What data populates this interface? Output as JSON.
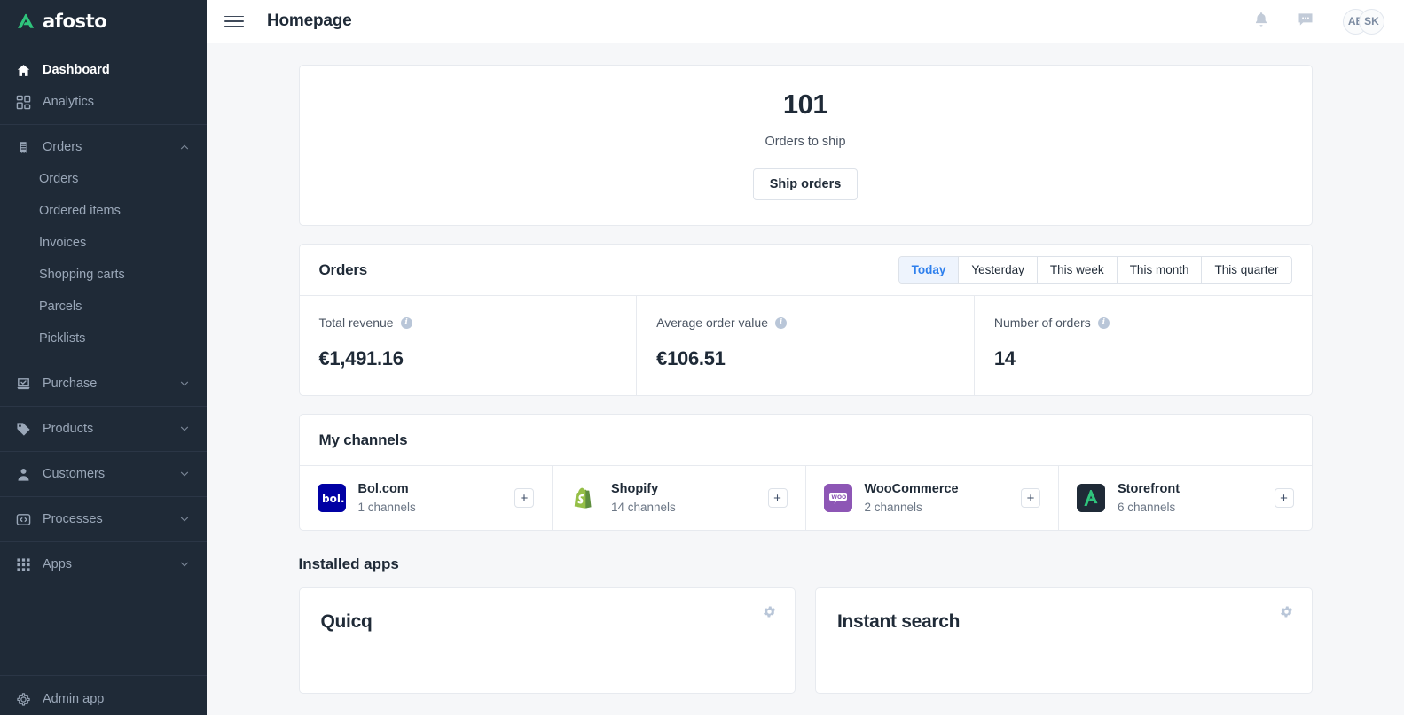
{
  "brand": {
    "name": "afosto",
    "mark_icon": "afosto-logo-icon",
    "accent": "#2fc47c"
  },
  "sidebar": {
    "primary": [
      {
        "label": "Dashboard",
        "icon": "home-icon",
        "active": true
      },
      {
        "label": "Analytics",
        "icon": "analytics-icon",
        "active": false
      }
    ],
    "orders_group": {
      "label": "Orders",
      "icon": "receipt-icon",
      "chevron": "chevron-up-icon",
      "expanded": true
    },
    "orders_children": [
      {
        "label": "Orders"
      },
      {
        "label": "Ordered items"
      },
      {
        "label": "Invoices"
      },
      {
        "label": "Shopping carts"
      },
      {
        "label": "Parcels"
      },
      {
        "label": "Picklists"
      }
    ],
    "groups": [
      {
        "label": "Purchase",
        "icon": "purchase-icon",
        "chevron": "chevron-down-icon"
      },
      {
        "label": "Products",
        "icon": "tag-icon",
        "chevron": "chevron-down-icon"
      },
      {
        "label": "Customers",
        "icon": "user-icon",
        "chevron": "chevron-down-icon"
      },
      {
        "label": "Processes",
        "icon": "code-icon",
        "chevron": "chevron-down-icon"
      },
      {
        "label": "Apps",
        "icon": "grid-icon",
        "chevron": "chevron-down-icon"
      }
    ],
    "bottom": {
      "label": "Admin app",
      "icon": "gear-icon"
    }
  },
  "topbar": {
    "menu_icon": "hamburger-icon",
    "title": "Homepage",
    "notifications_icon": "bell-icon",
    "messages_icon": "chat-icon",
    "avatars": [
      {
        "initials": "AB"
      },
      {
        "initials": "SK"
      }
    ]
  },
  "hero": {
    "count": "101",
    "label": "Orders to ship",
    "button": "Ship orders"
  },
  "orders": {
    "title": "Orders",
    "filters": [
      {
        "label": "Today",
        "active": true
      },
      {
        "label": "Yesterday",
        "active": false
      },
      {
        "label": "This week",
        "active": false
      },
      {
        "label": "This month",
        "active": false
      },
      {
        "label": "This quarter",
        "active": false
      }
    ],
    "stats": [
      {
        "label": "Total revenue",
        "value": "€1,491.16",
        "info_icon": "info-icon"
      },
      {
        "label": "Average order value",
        "value": "€106.51",
        "info_icon": "info-icon"
      },
      {
        "label": "Number of orders",
        "value": "14",
        "info_icon": "info-icon"
      }
    ]
  },
  "channels": {
    "title": "My channels",
    "items": [
      {
        "name": "Bol.com",
        "count": "1 channels",
        "logo_icon": "bol-logo-icon",
        "add_label": "+"
      },
      {
        "name": "Shopify",
        "count": "14 channels",
        "logo_icon": "shopify-logo-icon",
        "add_label": "+"
      },
      {
        "name": "WooCommerce",
        "count": "2 channels",
        "logo_icon": "woocommerce-logo-icon",
        "add_label": "+"
      },
      {
        "name": "Storefront",
        "count": "6 channels",
        "logo_icon": "afosto-storefront-logo-icon",
        "add_label": "+"
      }
    ]
  },
  "installed_apps": {
    "title": "Installed apps",
    "items": [
      {
        "name": "Quicq",
        "settings_icon": "gear-icon"
      },
      {
        "name": "Instant search",
        "settings_icon": "gear-icon"
      }
    ]
  }
}
